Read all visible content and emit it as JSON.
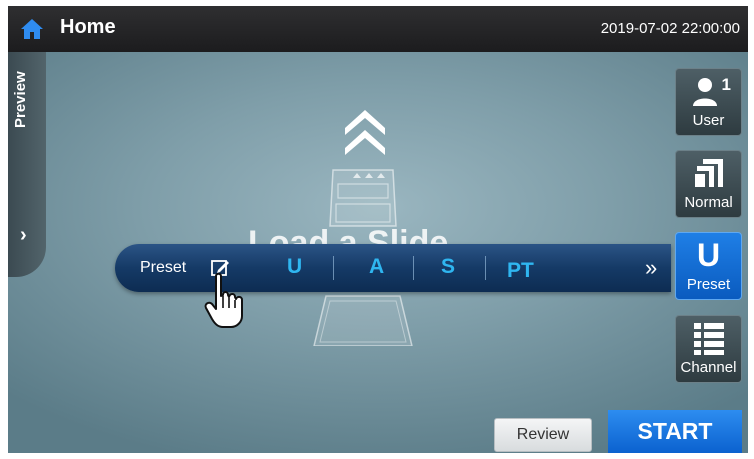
{
  "topbar": {
    "title": "Home",
    "datetime": "2019-07-02 22:00:00",
    "home_icon": "home-icon"
  },
  "preview_tab": {
    "label": "Preview",
    "arrow": "›"
  },
  "main": {
    "slide_caption": "Load a Slide"
  },
  "preset_bar": {
    "label": "Preset",
    "options": [
      "U",
      "A",
      "S",
      "PT"
    ],
    "more": "»"
  },
  "side_buttons": {
    "user": {
      "label": "User",
      "count": "1"
    },
    "normal": {
      "label": "Normal"
    },
    "preset": {
      "label": "Preset",
      "letter": "U"
    },
    "channel": {
      "label": "Channel"
    }
  },
  "bottom": {
    "review_label": "Review",
    "start_label": "START"
  },
  "colors": {
    "accent": "#1f7fe6",
    "option_text": "#2fb6f0",
    "topbar": "#222224"
  }
}
